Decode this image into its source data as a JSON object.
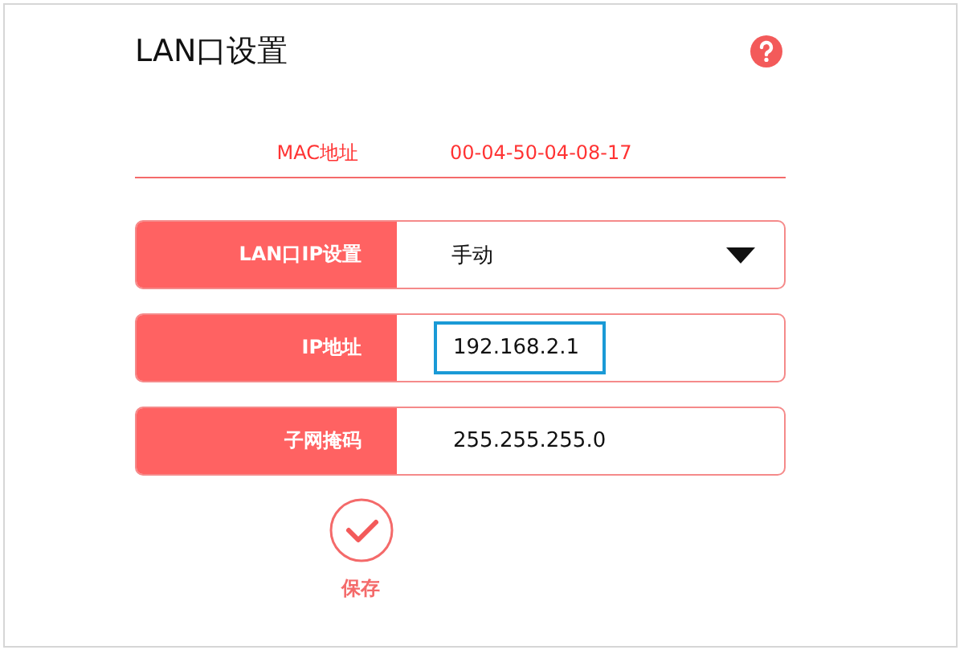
{
  "title": "LAN口设置",
  "mac": {
    "label": "MAC地址",
    "value": "00-04-50-04-08-17"
  },
  "fields": [
    {
      "kind": "select",
      "label": "LAN口IP设置",
      "value": "手动"
    },
    {
      "kind": "input",
      "label": "IP地址",
      "value": "192.168.2.1",
      "focused": true
    },
    {
      "kind": "input",
      "label": "子网掩码",
      "value": "255.255.255.0",
      "focused": false
    }
  ],
  "save_button": {
    "label": "保存"
  }
}
